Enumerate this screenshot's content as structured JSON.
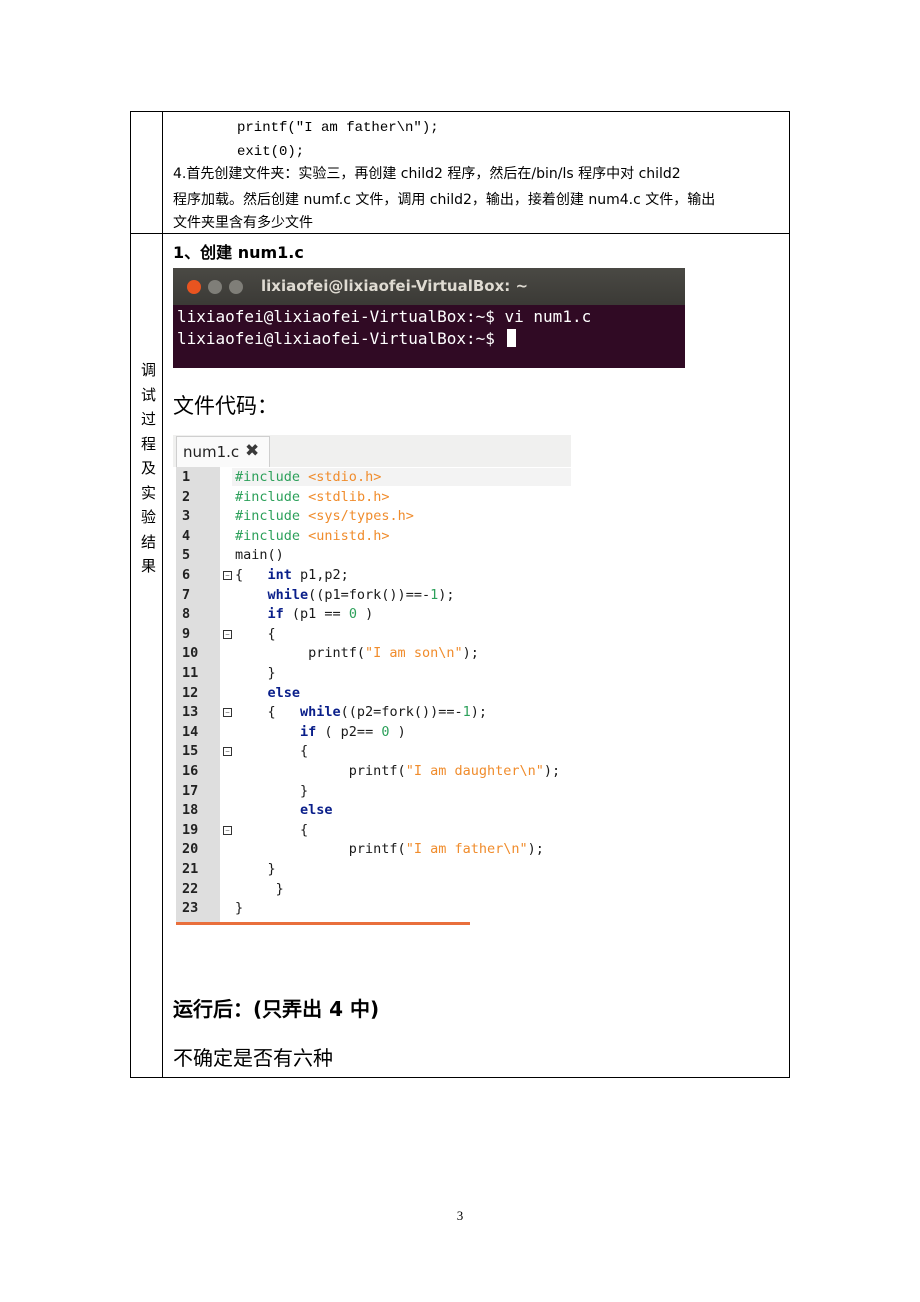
{
  "top_section": {
    "code_line_1": "printf(\"I am father\\n\");",
    "code_line_2": "exit(0);",
    "step4_line_1": "4.首先创建文件夹：实验三，再创建 child2 程序，然后在/bin/ls 程序中对 child2",
    "step4_line_2": "程序加载。然后创建 numf.c 文件，调用 child2，输出，接着创建 num4.c 文件，输出",
    "step4_line_3": "文件夹里含有多少文件"
  },
  "side_label": [
    "调",
    "试",
    "过",
    "程",
    "及",
    "实",
    "验",
    "结",
    "果"
  ],
  "step1_heading": "1、创建 num1.c",
  "terminal": {
    "title": "lixiaofei@lixiaofei-VirtualBox: ~",
    "line_1": "lixiaofei@lixiaofei-VirtualBox:~$ vi num1.c",
    "line_2": "lixiaofei@lixiaofei-VirtualBox:~$ ",
    "colors": {
      "titlebar": "#3c3b37",
      "body": "#300a24",
      "close_button": "#e95420"
    }
  },
  "code_heading": "文件代码：",
  "editor": {
    "tab_name": "num1.c",
    "tab_close_icon": "close-x-icon",
    "lines": [
      {
        "n": "1",
        "html": "<span class=\"pp\">#include</span> <span class=\"str\">&lt;stdio.h&gt;</span>"
      },
      {
        "n": "2",
        "html": "<span class=\"pp\">#include</span> <span class=\"str\">&lt;stdlib.h&gt;</span>"
      },
      {
        "n": "3",
        "html": "<span class=\"pp\">#include</span> <span class=\"str\">&lt;sys/types.h&gt;</span>"
      },
      {
        "n": "4",
        "html": "<span class=\"pp\">#include</span> <span class=\"str\">&lt;unistd.h&gt;</span>"
      },
      {
        "n": "5",
        "html": "main()"
      },
      {
        "n": "6",
        "html": "{   <span class=\"kw\">int</span> p1,p2;"
      },
      {
        "n": "7",
        "html": "    <span class=\"kw\">while</span>((p1=fork())==-<span class=\"num\">1</span>);"
      },
      {
        "n": "8",
        "html": "    <span class=\"kw\">if</span> (p1 == <span class=\"num\">0</span> )"
      },
      {
        "n": "9",
        "html": "    {"
      },
      {
        "n": "10",
        "html": "         printf(<span class=\"str\">\"I am son\\n\"</span>);"
      },
      {
        "n": "11",
        "html": "    }"
      },
      {
        "n": "12",
        "html": "    <span class=\"kw\">else</span>"
      },
      {
        "n": "13",
        "html": "    {   <span class=\"kw\">while</span>((p2=fork())==-<span class=\"num\">1</span>);"
      },
      {
        "n": "14",
        "html": "        <span class=\"kw\">if</span> ( p2== <span class=\"num\">0</span> )"
      },
      {
        "n": "15",
        "html": "        {"
      },
      {
        "n": "16",
        "html": "              printf(<span class=\"str\">\"I am daughter\\n\"</span>);"
      },
      {
        "n": "17",
        "html": "        }"
      },
      {
        "n": "18",
        "html": "        <span class=\"kw\">else</span>"
      },
      {
        "n": "19",
        "html": "        {"
      },
      {
        "n": "20",
        "html": "              printf(<span class=\"str\">\"I am father\\n\"</span>);"
      },
      {
        "n": "21",
        "html": "    }"
      },
      {
        "n": "22",
        "html": "     }"
      },
      {
        "n": "23",
        "html": "}"
      }
    ],
    "fold_marks_on_lines": [
      6,
      9,
      13,
      15,
      19
    ]
  },
  "after_run_heading": "运行后：(只弄出 4 中)",
  "after_run_note": "不确定是否有六种",
  "page_number": "3"
}
